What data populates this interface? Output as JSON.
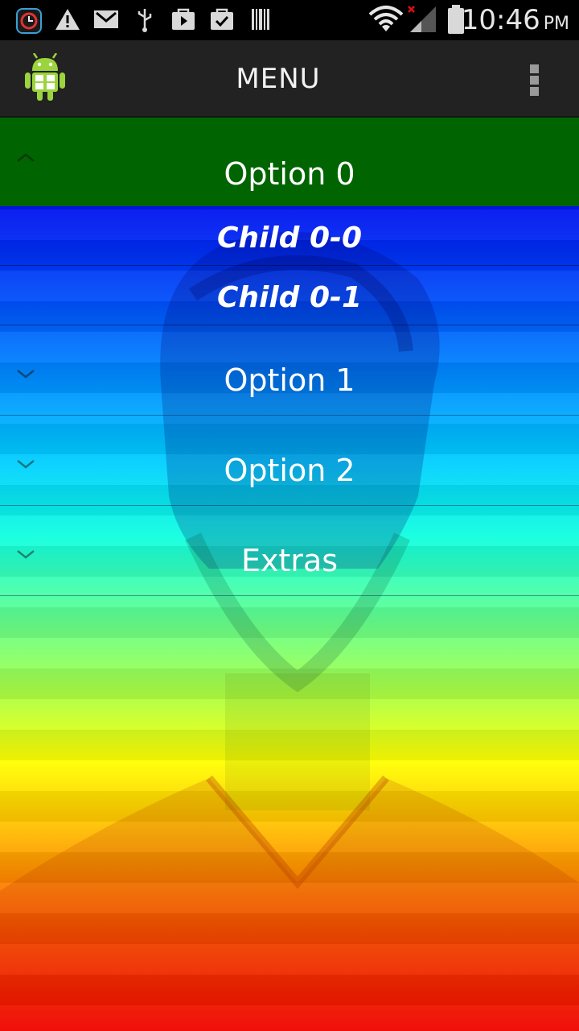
{
  "status_bar": {
    "time": "10:46",
    "ampm": "PM",
    "icons": [
      "clock-app-icon",
      "warning-icon",
      "email-icon",
      "usb-icon",
      "play-store-icon",
      "briefcase-check-icon",
      "barcode-icon",
      "wifi-icon",
      "signal-icon",
      "battery-icon"
    ]
  },
  "action_bar": {
    "title": "MENU",
    "app_icon": "android-robot-icon",
    "overflow_icon": "overflow-menu-icon"
  },
  "menu": {
    "groups": [
      {
        "label": "Option 0",
        "expanded": true,
        "indicator": "chevron-up-icon",
        "children": [
          {
            "label": "Child 0-0"
          },
          {
            "label": "Child 0-1"
          }
        ]
      },
      {
        "label": "Option 1",
        "expanded": false,
        "indicator": "chevron-down-icon"
      },
      {
        "label": "Option 2",
        "expanded": false,
        "indicator": "chevron-down-icon"
      },
      {
        "label": "Extras",
        "expanded": false,
        "indicator": "chevron-down-icon"
      }
    ]
  },
  "colors": {
    "expanded_group_bg": "#006400",
    "action_bar_bg": "#222222",
    "status_bar_bg": "#000000"
  }
}
